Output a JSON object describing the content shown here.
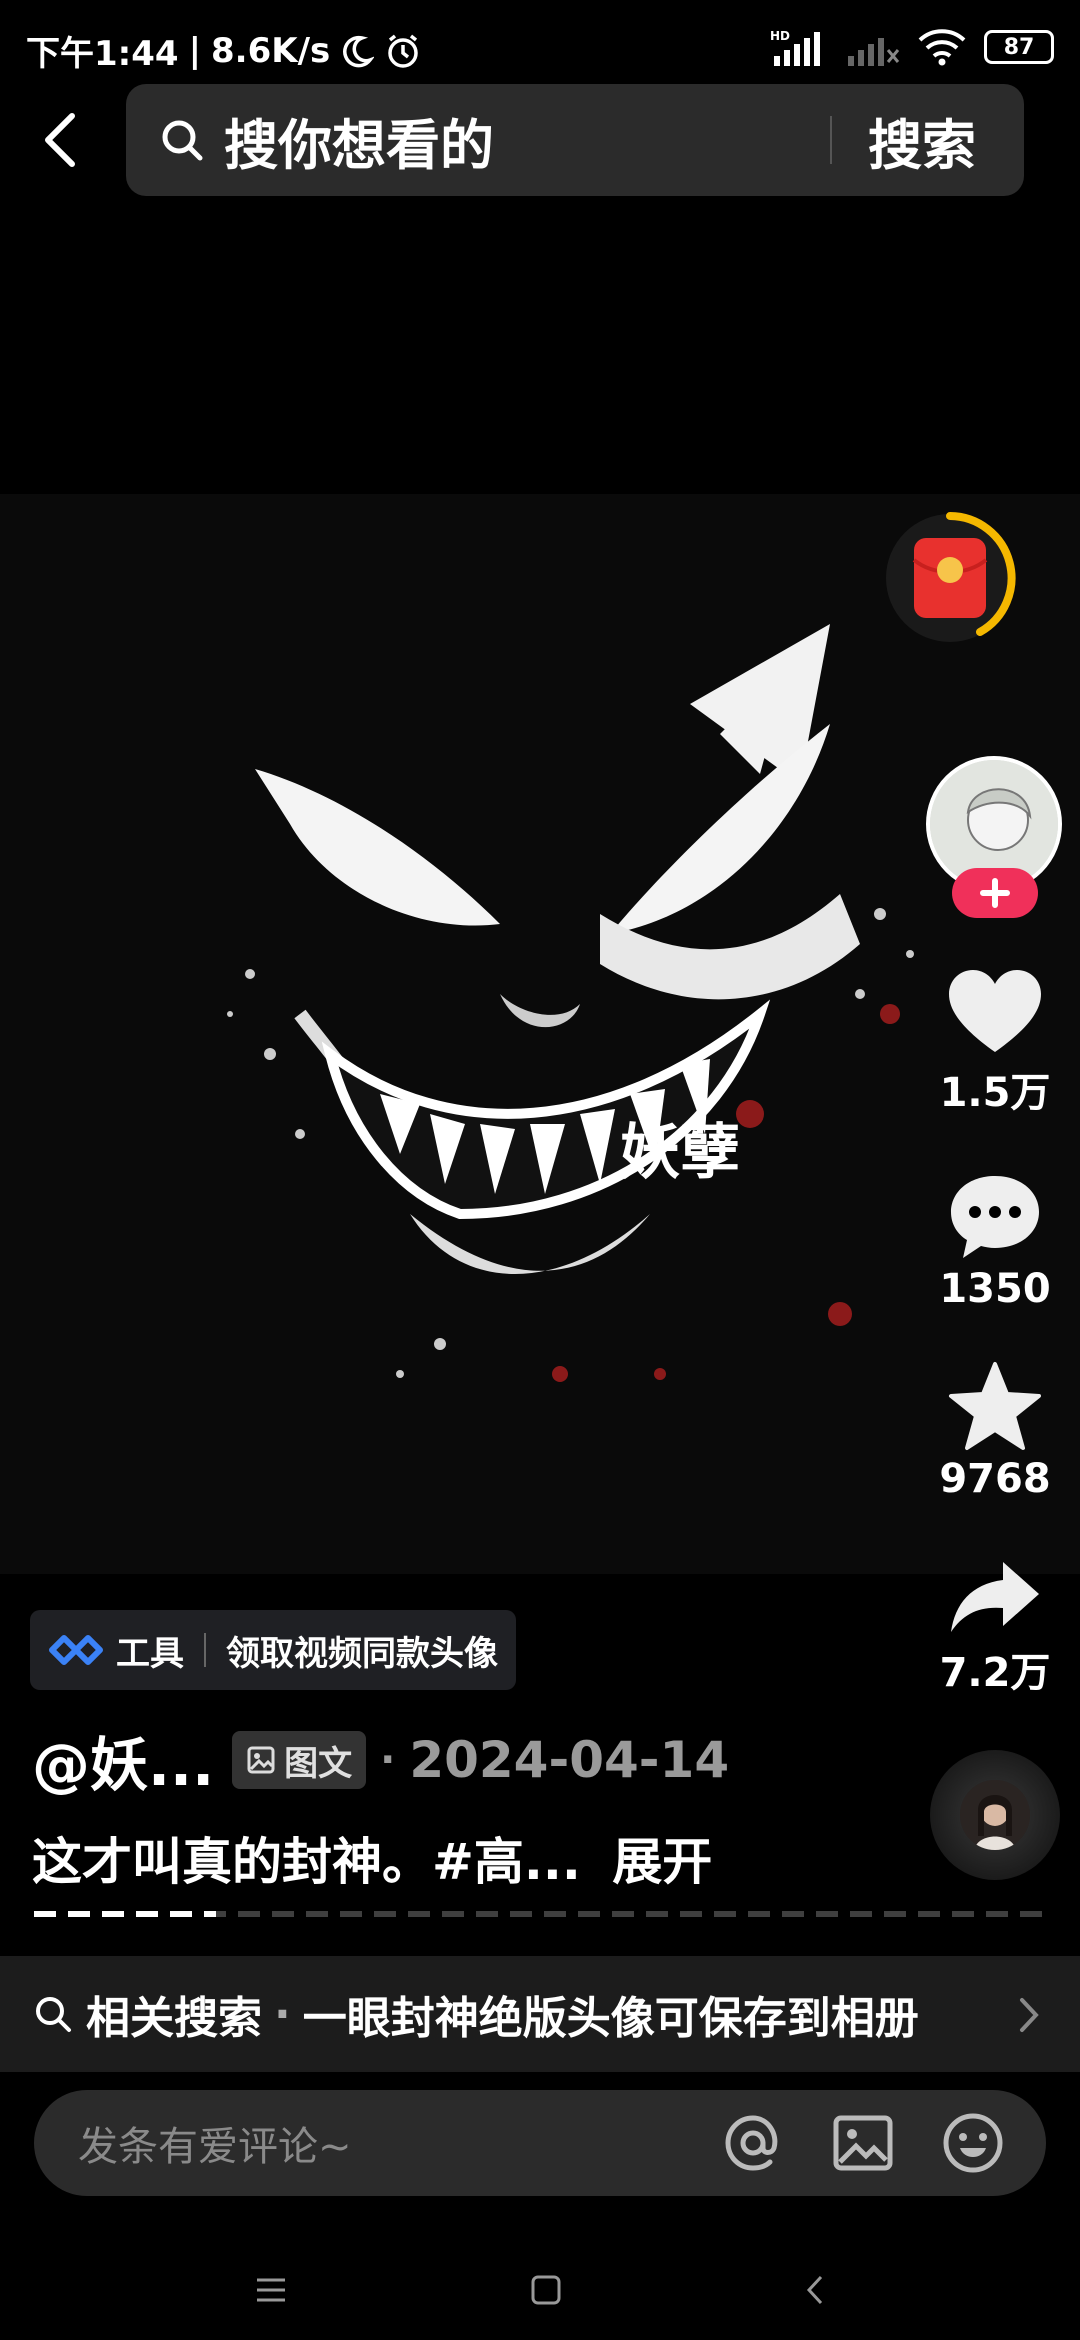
{
  "status_bar": {
    "time": "下午1:44",
    "net_speed": "8.6K/s",
    "battery": "87"
  },
  "search": {
    "placeholder": "搜你想看的",
    "button_label": "搜索"
  },
  "post": {
    "image_caption": "妖孽"
  },
  "actions": {
    "likes": "1.5万",
    "comments": "1350",
    "favorites": "9768",
    "shares": "7.2万"
  },
  "tool_tag": {
    "label": "工具",
    "text": "领取视频同款头像"
  },
  "author": {
    "name": "@妖...",
    "type_badge": "图文",
    "separator": "·",
    "date": "2024-04-14"
  },
  "description": {
    "text": "这才叫真的封神。#高...",
    "expand": "展开"
  },
  "progress": {
    "fraction": 0.18
  },
  "related": {
    "label": "相关搜索",
    "separator": "·",
    "query": "一眼封神绝版头像可保存到相册"
  },
  "comment": {
    "placeholder": "发条有爱评论~"
  },
  "colors": {
    "follow": "#f0305a",
    "red_packet": "#e8312e",
    "ring": "#f5b800"
  }
}
